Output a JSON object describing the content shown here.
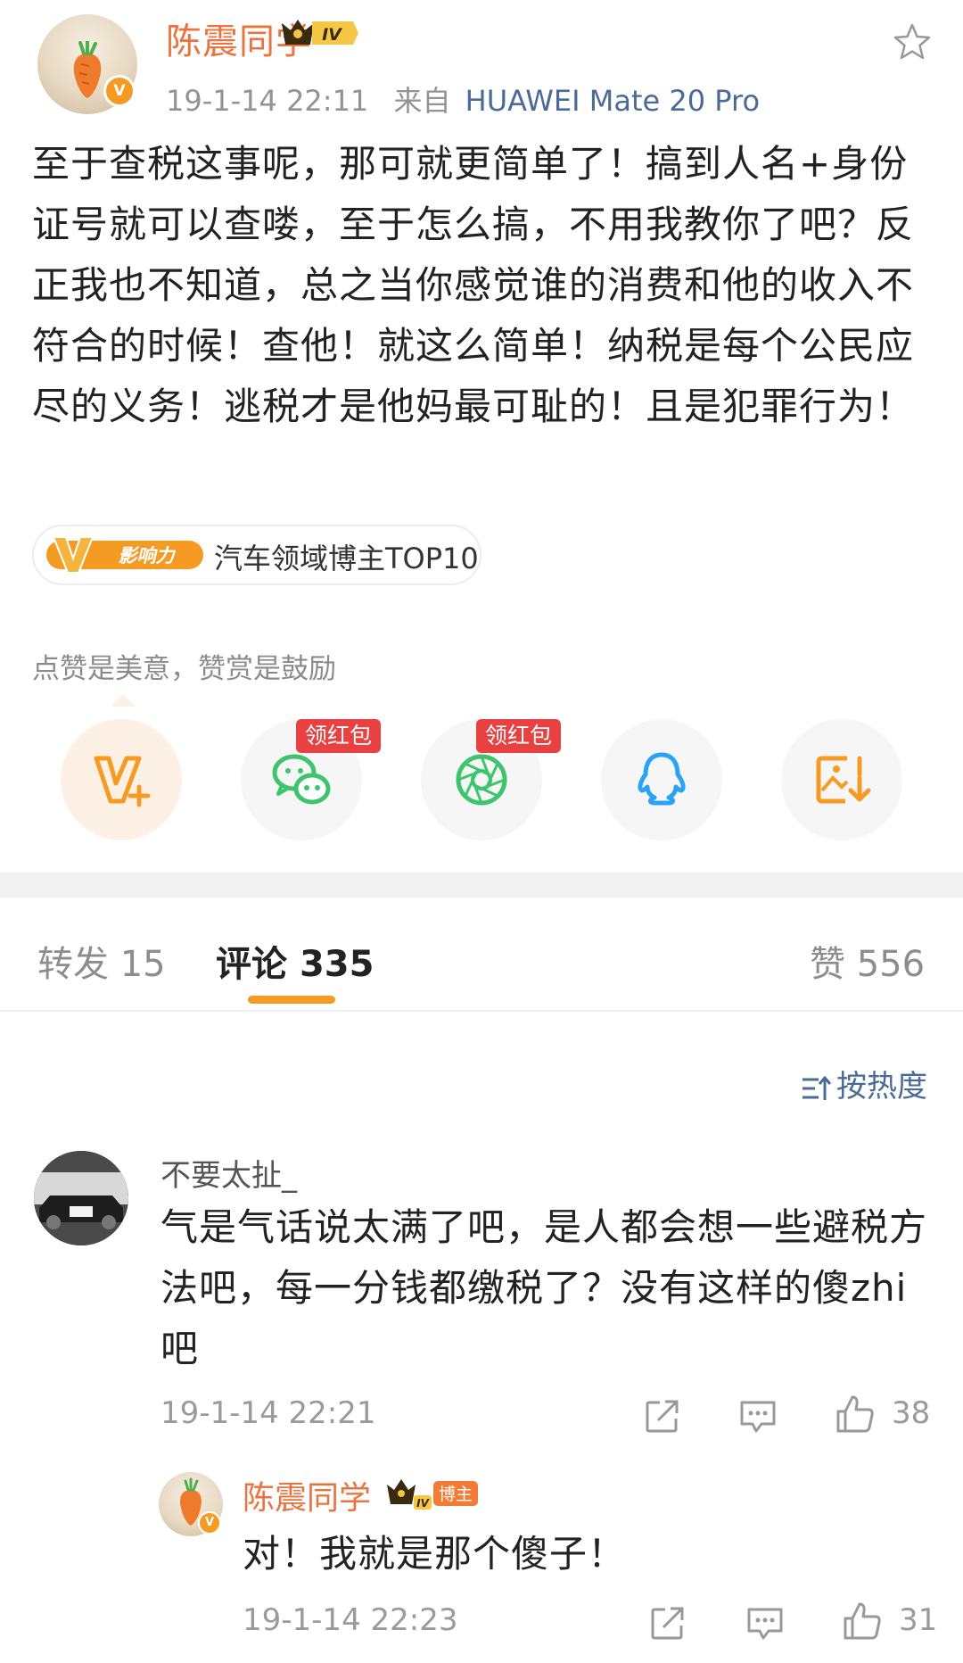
{
  "post": {
    "author": "陈震同学",
    "level": "IV",
    "timestamp": "19-1-14 22:11",
    "source_prefix": "来自",
    "device": "HUAWEI Mate 20 Pro",
    "text": "至于查税这事呢，那可就更简单了！搞到人名+身份证号就可以查喽，至于怎么搞，不用我教你了吧？反正我也不知道，总之当你感觉谁的消费和他的收入不符合的时候！查他！就这么简单！纳税是每个公民应尽的义务！逃税才是他妈最可耻的！且是犯罪行为！",
    "influence_tag": "影响力",
    "influence_text": "汽车领域博主TOP10"
  },
  "reward": {
    "hint": "点赞是美意，赞赏是鼓励",
    "badges": [
      "领红包",
      "领红包"
    ],
    "icons": [
      "v-plus-icon",
      "wechat-icon",
      "moments-icon",
      "qq-icon",
      "save-image-icon"
    ]
  },
  "tabs": {
    "repost_label": "转发",
    "repost_count": "15",
    "comment_label": "评论",
    "comment_count": "335",
    "like_label": "赞",
    "like_count": "556"
  },
  "sort_label": "按热度",
  "comment": {
    "user": "不要太扯_",
    "text": "气是气话说太满了吧，是人都会想一些避税方法吧，每一分钱都缴税了？没有这样的傻zhi吧",
    "timestamp": "19-1-14 22:21",
    "likes": "38"
  },
  "reply": {
    "user": "陈震同学",
    "level": "IV",
    "role_badge": "博主",
    "text": "对！我就是那个傻子！",
    "timestamp": "19-1-14 22:23",
    "likes": "31"
  },
  "colors": {
    "accent_orange": "#F59A23",
    "author_name": "#EB7340",
    "link_blue": "#4A6B96",
    "red_packet": "#E94141",
    "wechat_green": "#3FC46E"
  }
}
